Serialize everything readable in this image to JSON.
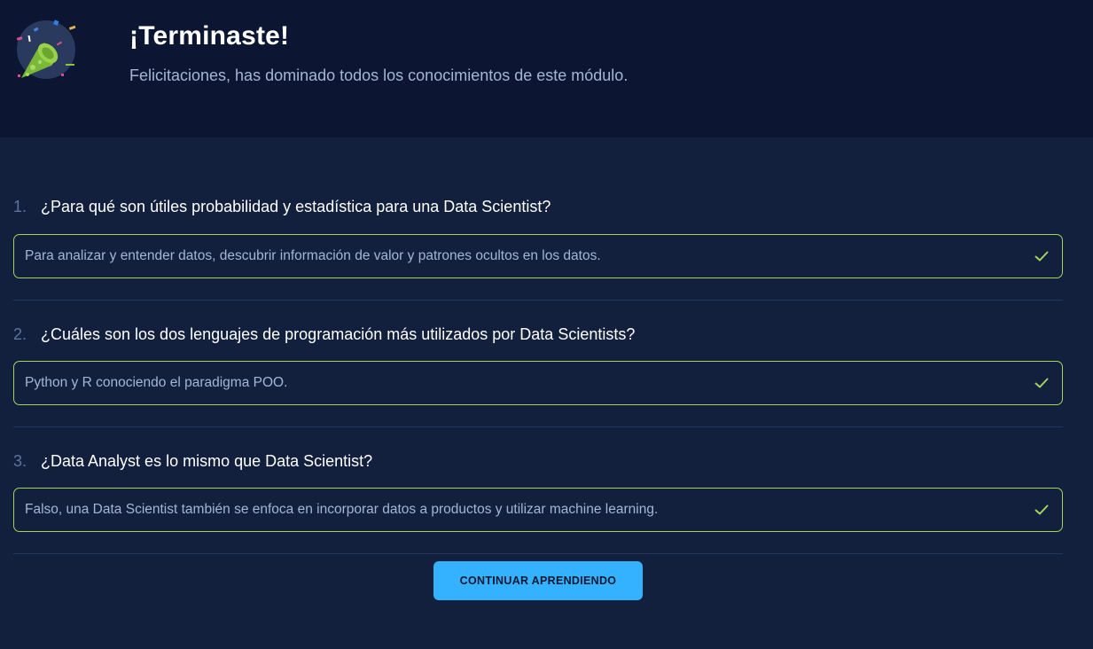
{
  "header": {
    "title": "¡Terminaste!",
    "subtitle": "Felicitaciones, has dominado todos los conocimientos de este módulo.",
    "icon": "party-popper-icon"
  },
  "questions": [
    {
      "number": "1.",
      "text": "¿Para qué son útiles probabilidad y estadística para una Data Scientist?",
      "answer": "Para analizar y entender datos, descubrir información de valor y patrones ocultos en los datos.",
      "status": "correct"
    },
    {
      "number": "2.",
      "text": "¿Cuáles son los dos lenguajes de programación más utilizados por Data Scientists?",
      "answer": "Python y R conociendo el paradigma POO.",
      "status": "correct"
    },
    {
      "number": "3.",
      "text": "¿Data Analyst es lo mismo que Data Scientist?",
      "answer": "Falso, una Data Scientist también se enfoca en incorporar datos a productos y utilizar machine learning.",
      "status": "correct"
    }
  ],
  "continue_label": "CONTINUAR APRENDIENDO",
  "colors": {
    "header_bg": "#0c1632",
    "page_bg": "#121f3d",
    "correct_border": "#a6d45a",
    "button_bg": "#34b2ff"
  }
}
